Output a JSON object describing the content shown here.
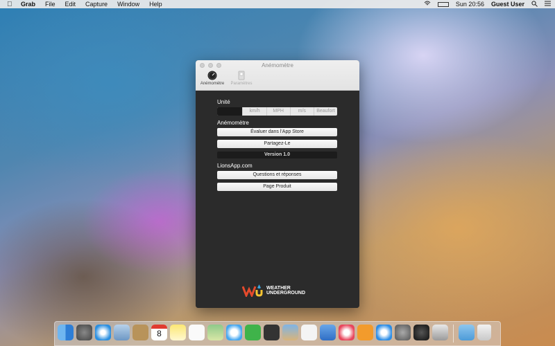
{
  "menubar": {
    "app_name": "Grab",
    "menus": [
      "File",
      "Edit",
      "Capture",
      "Window",
      "Help"
    ],
    "clock": "Sun 20:56",
    "user": "Guest User"
  },
  "window": {
    "title": "Anémomètre",
    "tabs": [
      "Anémomètre",
      "Paramètres"
    ]
  },
  "settings": {
    "unit_label": "Unité",
    "units": [
      "",
      "km/h",
      "MPH",
      "m/s",
      "Beaufort"
    ],
    "section_app": "Anémomètre",
    "rate_button": "Évaluer dans l'App Store",
    "share_button": "Partagez-Le",
    "version": "Version 1.0",
    "section_site": "LionsApp.com",
    "faq_button": "Questions et réponses",
    "product_button": "Page Produit"
  },
  "branding": {
    "weather_underground_line1": "WEATHER",
    "weather_underground_line2": "UNDERGROUND"
  },
  "dock": {
    "calendar_day": "8",
    "apps": [
      "finder-icon",
      "launchpad-icon",
      "safari-icon",
      "mail-icon",
      "contacts-icon",
      "calendar-icon",
      "notes-icon",
      "reminders-icon",
      "maps-icon",
      "messages-icon",
      "facetime-icon",
      "photo-booth-icon",
      "iphoto-icon",
      "numbers-icon",
      "keynote-icon",
      "itunes-icon",
      "ibooks-icon",
      "app-store-icon",
      "system-preferences-icon",
      "anemometre-icon",
      "preview-icon",
      "downloads-icon",
      "trash-icon"
    ]
  }
}
